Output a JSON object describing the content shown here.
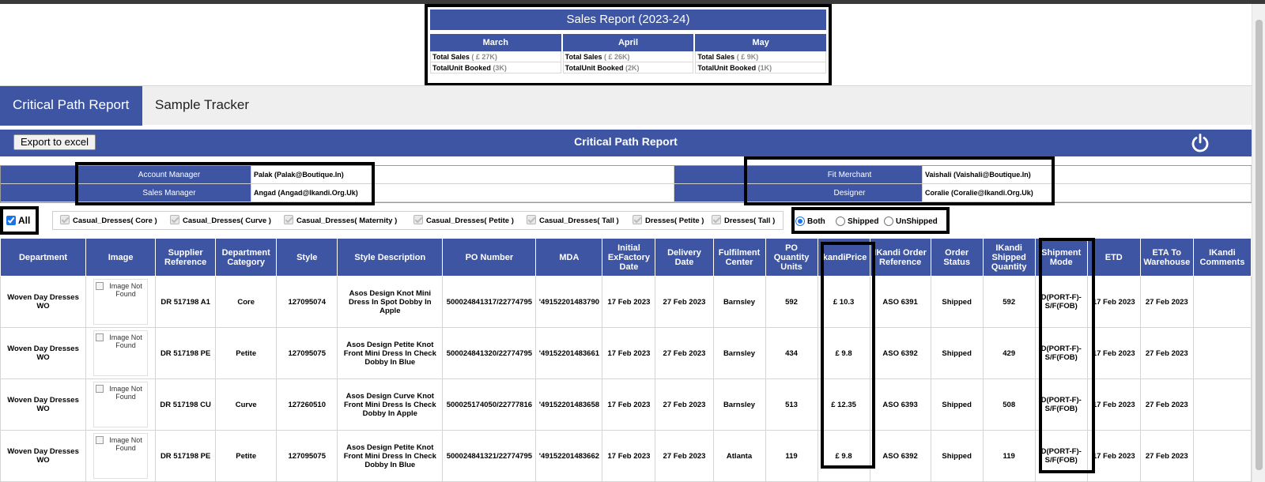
{
  "sales_report": {
    "title": "Sales Report (2023-24)",
    "months": [
      {
        "name": "March",
        "total_sales_label": "Total Sales",
        "total_sales_value": "( £ 27K)",
        "units_label": "TotalUnit Booked",
        "units_value": "(3K)"
      },
      {
        "name": "April",
        "total_sales_label": "Total Sales",
        "total_sales_value": "( £ 26K)",
        "units_label": "TotalUnit Booked",
        "units_value": "(2K)"
      },
      {
        "name": "May",
        "total_sales_label": "Total Sales",
        "total_sales_value": "( £ 9K)",
        "units_label": "TotalUnit Booked",
        "units_value": "(1K)"
      }
    ]
  },
  "tabs": {
    "active": "Critical Path Report",
    "inactive": "Sample Tracker"
  },
  "header": {
    "export_label": "Export to excel",
    "title": "Critical Path Report",
    "power_icon": "power-icon"
  },
  "info": {
    "account_manager_label": "Account Manager",
    "account_manager_value": "Palak (Palak@Boutique.In)",
    "sales_manager_label": "Sales Manager",
    "sales_manager_value": "Angad (Angad@Ikandi.Org.Uk)",
    "fit_merchant_label": "Fit Merchant",
    "fit_merchant_value": "Vaishali (Vaishali@Boutique.In)",
    "designer_label": "Designer",
    "designer_value": "Coralie (Coralie@Ikandi.Org.Uk)"
  },
  "filters": {
    "all_label": "All",
    "categories": [
      "Casual_Dresses( Core )",
      "Casual_Dresses( Curve )",
      "Casual_Dresses( Maternity )",
      "Casual_Dresses( Petite )",
      "Casual_Dresses( Tall )",
      "Dresses( Petite )",
      "Dresses( Tall )"
    ],
    "shipment_options": [
      "Both",
      "Shipped",
      "UnShipped"
    ],
    "selected_shipment": "Both"
  },
  "table": {
    "columns": [
      "Department",
      "Image",
      "Supplier Reference",
      "Department Category",
      "Style",
      "Style Description",
      "PO Number",
      "MDA",
      "Initial ExFactory Date",
      "Delivery Date",
      "Fulfilment Center",
      "PO Quantity Units",
      "IkandiPrice",
      "IKandi Order Reference",
      "Order Status",
      "IKandi Shipped Quantity",
      "Shipment Mode",
      "ETD",
      "ETA To Warehouse",
      "IKandi Comments"
    ],
    "image_alt": "Image Not Found",
    "rows": [
      [
        "Woven Day Dresses WO",
        "",
        "DR 517198 A1",
        "Core",
        "127095074",
        "Asos Design Knot Mini Dress In Spot Dobby In Apple",
        "500024841317/22774795",
        "'49152201483790",
        "17 Feb 2023",
        "27 Feb 2023",
        "Barnsley",
        "592",
        "£ 10.3",
        "ASO 6391",
        "Shipped",
        "592",
        "D(PORT-F)-S/F(FOB)",
        "17 Feb 2023",
        "27 Feb 2023",
        ""
      ],
      [
        "Woven Day Dresses WO",
        "",
        "DR 517198 PE",
        "Petite",
        "127095075",
        "Asos Design Petite Knot Front Mini Dress In Check Dobby In Blue",
        "500024841320/22774795",
        "'49152201483661",
        "17 Feb 2023",
        "27 Feb 2023",
        "Barnsley",
        "434",
        "£ 9.8",
        "ASO 6392",
        "Shipped",
        "429",
        "D(PORT-F)-S/F(FOB)",
        "17 Feb 2023",
        "27 Feb 2023",
        ""
      ],
      [
        "Woven Day Dresses WO",
        "",
        "DR 517198 CU",
        "Curve",
        "127260510",
        "Asos Design Curve Knot Front Mini Dress Is Check Dobby In Apple",
        "500025174050/22777816",
        "'49152201483658",
        "17 Feb 2023",
        "27 Feb 2023",
        "Barnsley",
        "513",
        "£ 12.35",
        "ASO 6393",
        "Shipped",
        "508",
        "D(PORT-F)-S/F(FOB)",
        "17 Feb 2023",
        "27 Feb 2023",
        ""
      ],
      [
        "Woven Day Dresses WO",
        "",
        "DR 517198 PE",
        "Petite",
        "127095075",
        "Asos Design Petite Knot Front Mini Dress In Check Dobby In Blue",
        "500024841321/22774795",
        "'49152201483662",
        "17 Feb 2023",
        "27 Feb 2023",
        "Atlanta",
        "119",
        "£ 9.8",
        "ASO 6392",
        "Shipped",
        "119",
        "D(PORT-F)-S/F(FOB)",
        "17 Feb 2023",
        "27 Feb 2023",
        ""
      ]
    ]
  }
}
